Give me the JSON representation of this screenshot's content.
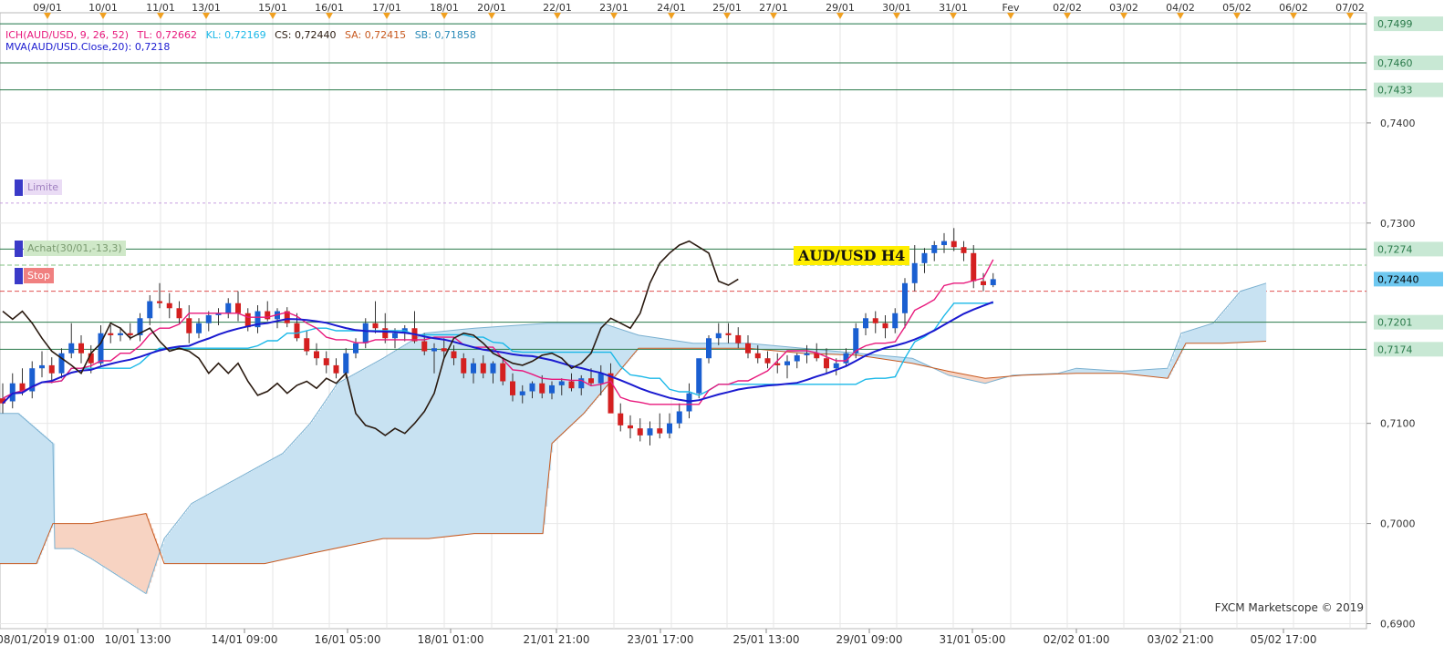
{
  "window": {
    "title": "AUD/USD H4"
  },
  "indicators": {
    "ich": {
      "label": "ICH(AUD/USD, 9, 26, 52)",
      "tl": "TL: 0,72662",
      "kl": "KL: 0,72169",
      "cs": "CS: 0,72440",
      "sa": "SA: 0,72415",
      "sb": "SB: 0,71858"
    },
    "mva": {
      "label": "MVA(AUD/USD.Close,20): 0,7218"
    }
  },
  "orders": [
    {
      "label": "Limite",
      "price": 0.732,
      "color": "#c8a0e0",
      "bg": "#eadcf5",
      "text_color": "#a080c0"
    },
    {
      "label": "Achat(30/01,-13,3)",
      "price": 0.7274,
      "color": "#3a7a3a",
      "bg": "#cfe8c8",
      "text_color": "#7a9a70"
    },
    {
      "label": "Stop",
      "price": 0.7232,
      "color": "#e05050",
      "bg": "#f08080",
      "text_color": "#ffffff"
    }
  ],
  "credit": "FXCM Marketscope © 2019",
  "colors": {
    "bull": "#1a5fd1",
    "bear": "#d42020",
    "tenkan": "#e8187c",
    "kijun": "#1ab8e8",
    "chikou": "#2a1a10",
    "mva": "#1a1ad0",
    "cloud_bull": "#c8e2f2",
    "cloud_bear": "#f7d3c2",
    "senkou_b_line": "#c85a20",
    "hline": "#2a7a4a",
    "current_price_bg": "#6ec8f0"
  },
  "chart_data": {
    "type": "candlestick",
    "title": "AUD/USD H4",
    "timeframe": "H4",
    "ylim": [
      0.6895,
      0.751
    ],
    "y_ticks": [
      "0,7400",
      "0,7300",
      "0,7100",
      "0,7000",
      "0,6900"
    ],
    "y_tick_values": [
      0.74,
      0.73,
      0.71,
      0.7,
      0.69
    ],
    "current_price": "0,72440",
    "current_price_value": 0.7244,
    "top_date_labels": [
      "09/01",
      "10/01",
      "11/01",
      "13/01",
      "15/01",
      "16/01",
      "17/01",
      "18/01",
      "20/01",
      "22/01",
      "23/01",
      "24/01",
      "25/01",
      "27/01",
      "29/01",
      "30/01",
      "31/01",
      "Fev",
      "02/02",
      "03/02",
      "04/02",
      "05/02",
      "06/02",
      "07/02"
    ],
    "bottom_date_labels": [
      "08/01/2019 01:00",
      "10/01 13:00",
      "14/01 09:00",
      "16/01 05:00",
      "18/01 01:00",
      "21/01 21:00",
      "23/01 17:00",
      "25/01 13:00",
      "29/01 09:00",
      "31/01 05:00",
      "02/02 01:00",
      "03/02 21:00",
      "05/02 17:00"
    ],
    "horizontal_lines": [
      {
        "label": "0,7499",
        "value": 0.7499
      },
      {
        "label": "0,7460",
        "value": 0.746
      },
      {
        "label": "0,7433",
        "value": 0.7433
      },
      {
        "label": "0,7274",
        "value": 0.7274
      },
      {
        "label": "0,7201",
        "value": 0.7201
      },
      {
        "label": "0,7174",
        "value": 0.7174
      }
    ],
    "candles": [
      [
        0.7125,
        0.714,
        0.711,
        0.712
      ],
      [
        0.7122,
        0.715,
        0.7115,
        0.714
      ],
      [
        0.714,
        0.7155,
        0.7128,
        0.7132
      ],
      [
        0.7132,
        0.7162,
        0.7125,
        0.7155
      ],
      [
        0.7155,
        0.7172,
        0.7146,
        0.7158
      ],
      [
        0.7158,
        0.7166,
        0.714,
        0.715
      ],
      [
        0.715,
        0.7175,
        0.7145,
        0.717
      ],
      [
        0.717,
        0.72,
        0.7165,
        0.718
      ],
      [
        0.718,
        0.7188,
        0.716,
        0.717
      ],
      [
        0.717,
        0.7178,
        0.715,
        0.716
      ],
      [
        0.716,
        0.7198,
        0.7158,
        0.719
      ],
      [
        0.719,
        0.7198,
        0.718,
        0.7188
      ],
      [
        0.7188,
        0.7196,
        0.7182,
        0.719
      ],
      [
        0.719,
        0.72,
        0.7183,
        0.7188
      ],
      [
        0.7188,
        0.721,
        0.7182,
        0.7205
      ],
      [
        0.7205,
        0.7228,
        0.7198,
        0.7222
      ],
      [
        0.7222,
        0.724,
        0.7215,
        0.722
      ],
      [
        0.722,
        0.723,
        0.7205,
        0.7215
      ],
      [
        0.7215,
        0.7222,
        0.72,
        0.7205
      ],
      [
        0.7205,
        0.7218,
        0.718,
        0.719
      ],
      [
        0.719,
        0.7205,
        0.7185,
        0.72
      ],
      [
        0.72,
        0.7212,
        0.7192,
        0.7208
      ],
      [
        0.7208,
        0.7215,
        0.7198,
        0.721
      ],
      [
        0.721,
        0.7225,
        0.7205,
        0.722
      ],
      [
        0.722,
        0.7232,
        0.7202,
        0.721
      ],
      [
        0.721,
        0.7215,
        0.7192,
        0.7196
      ],
      [
        0.7196,
        0.7218,
        0.719,
        0.7212
      ],
      [
        0.7212,
        0.7222,
        0.7202,
        0.7204
      ],
      [
        0.7204,
        0.7215,
        0.7195,
        0.7212
      ],
      [
        0.7212,
        0.7216,
        0.7196,
        0.72
      ],
      [
        0.72,
        0.721,
        0.7182,
        0.7185
      ],
      [
        0.7185,
        0.7192,
        0.7168,
        0.7172
      ],
      [
        0.7172,
        0.718,
        0.7158,
        0.7165
      ],
      [
        0.7165,
        0.7172,
        0.715,
        0.7158
      ],
      [
        0.7158,
        0.7165,
        0.7145,
        0.715
      ],
      [
        0.715,
        0.7175,
        0.7145,
        0.717
      ],
      [
        0.717,
        0.7185,
        0.7165,
        0.718
      ],
      [
        0.718,
        0.7205,
        0.7175,
        0.72
      ],
      [
        0.72,
        0.7222,
        0.719,
        0.7195
      ],
      [
        0.7195,
        0.721,
        0.718,
        0.7185
      ],
      [
        0.7185,
        0.7195,
        0.7175,
        0.719
      ],
      [
        0.719,
        0.7198,
        0.7182,
        0.7195
      ],
      [
        0.7195,
        0.7212,
        0.718,
        0.7182
      ],
      [
        0.7182,
        0.719,
        0.7168,
        0.7172
      ],
      [
        0.7172,
        0.718,
        0.715,
        0.7175
      ],
      [
        0.7175,
        0.7185,
        0.7165,
        0.7172
      ],
      [
        0.7172,
        0.7178,
        0.7158,
        0.7165
      ],
      [
        0.7165,
        0.717,
        0.7145,
        0.715
      ],
      [
        0.715,
        0.7165,
        0.714,
        0.716
      ],
      [
        0.716,
        0.7168,
        0.7145,
        0.715
      ],
      [
        0.715,
        0.7162,
        0.714,
        0.716
      ],
      [
        0.716,
        0.7166,
        0.7138,
        0.7142
      ],
      [
        0.7142,
        0.715,
        0.7122,
        0.7128
      ],
      [
        0.7128,
        0.7138,
        0.712,
        0.7132
      ],
      [
        0.7132,
        0.7142,
        0.7125,
        0.714
      ],
      [
        0.714,
        0.7148,
        0.7125,
        0.713
      ],
      [
        0.713,
        0.7142,
        0.7124,
        0.7138
      ],
      [
        0.7138,
        0.7145,
        0.7128,
        0.7142
      ],
      [
        0.7142,
        0.715,
        0.7132,
        0.7135
      ],
      [
        0.7135,
        0.7148,
        0.7128,
        0.7145
      ],
      [
        0.7145,
        0.7155,
        0.7138,
        0.714
      ],
      [
        0.714,
        0.7158,
        0.7128,
        0.715
      ],
      [
        0.715,
        0.716,
        0.714,
        0.711
      ],
      [
        0.711,
        0.712,
        0.7092,
        0.7098
      ],
      [
        0.7098,
        0.7108,
        0.7085,
        0.7095
      ],
      [
        0.7095,
        0.7105,
        0.7082,
        0.7088
      ],
      [
        0.7088,
        0.7102,
        0.7078,
        0.7095
      ],
      [
        0.7095,
        0.711,
        0.7085,
        0.709
      ],
      [
        0.709,
        0.711,
        0.7085,
        0.71
      ],
      [
        0.71,
        0.712,
        0.7095,
        0.7112
      ],
      [
        0.7112,
        0.714,
        0.7105,
        0.713
      ],
      [
        0.713,
        0.716,
        0.7125,
        0.7165
      ],
      [
        0.7165,
        0.7188,
        0.716,
        0.7185
      ],
      [
        0.7185,
        0.72,
        0.7178,
        0.719
      ],
      [
        0.719,
        0.72,
        0.718,
        0.7188
      ],
      [
        0.7188,
        0.7196,
        0.7175,
        0.718
      ],
      [
        0.718,
        0.7188,
        0.7165,
        0.717
      ],
      [
        0.717,
        0.7178,
        0.716,
        0.7165
      ],
      [
        0.7165,
        0.7172,
        0.7155,
        0.716
      ],
      [
        0.716,
        0.717,
        0.715,
        0.7158
      ],
      [
        0.7158,
        0.7168,
        0.7145,
        0.7162
      ],
      [
        0.7162,
        0.717,
        0.7155,
        0.7168
      ],
      [
        0.7168,
        0.7178,
        0.716,
        0.717
      ],
      [
        0.717,
        0.718,
        0.7162,
        0.7165
      ],
      [
        0.7165,
        0.7175,
        0.715,
        0.7155
      ],
      [
        0.7155,
        0.7165,
        0.7148,
        0.716
      ],
      [
        0.716,
        0.7175,
        0.7158,
        0.717
      ],
      [
        0.717,
        0.72,
        0.7165,
        0.7195
      ],
      [
        0.7195,
        0.721,
        0.7188,
        0.7205
      ],
      [
        0.7205,
        0.7212,
        0.719,
        0.72
      ],
      [
        0.72,
        0.7208,
        0.7185,
        0.7195
      ],
      [
        0.7195,
        0.7215,
        0.719,
        0.721
      ],
      [
        0.721,
        0.7245,
        0.7195,
        0.724
      ],
      [
        0.724,
        0.7278,
        0.7232,
        0.726
      ],
      [
        0.726,
        0.7275,
        0.725,
        0.727
      ],
      [
        0.727,
        0.7282,
        0.7262,
        0.7278
      ],
      [
        0.7278,
        0.729,
        0.727,
        0.7282
      ],
      [
        0.7282,
        0.7295,
        0.7272,
        0.7276
      ],
      [
        0.7276,
        0.7282,
        0.7262,
        0.727
      ],
      [
        0.727,
        0.7278,
        0.7235,
        0.7242
      ],
      [
        0.7242,
        0.725,
        0.7232,
        0.7238
      ],
      [
        0.7238,
        0.725,
        0.7236,
        0.7244
      ]
    ]
  }
}
